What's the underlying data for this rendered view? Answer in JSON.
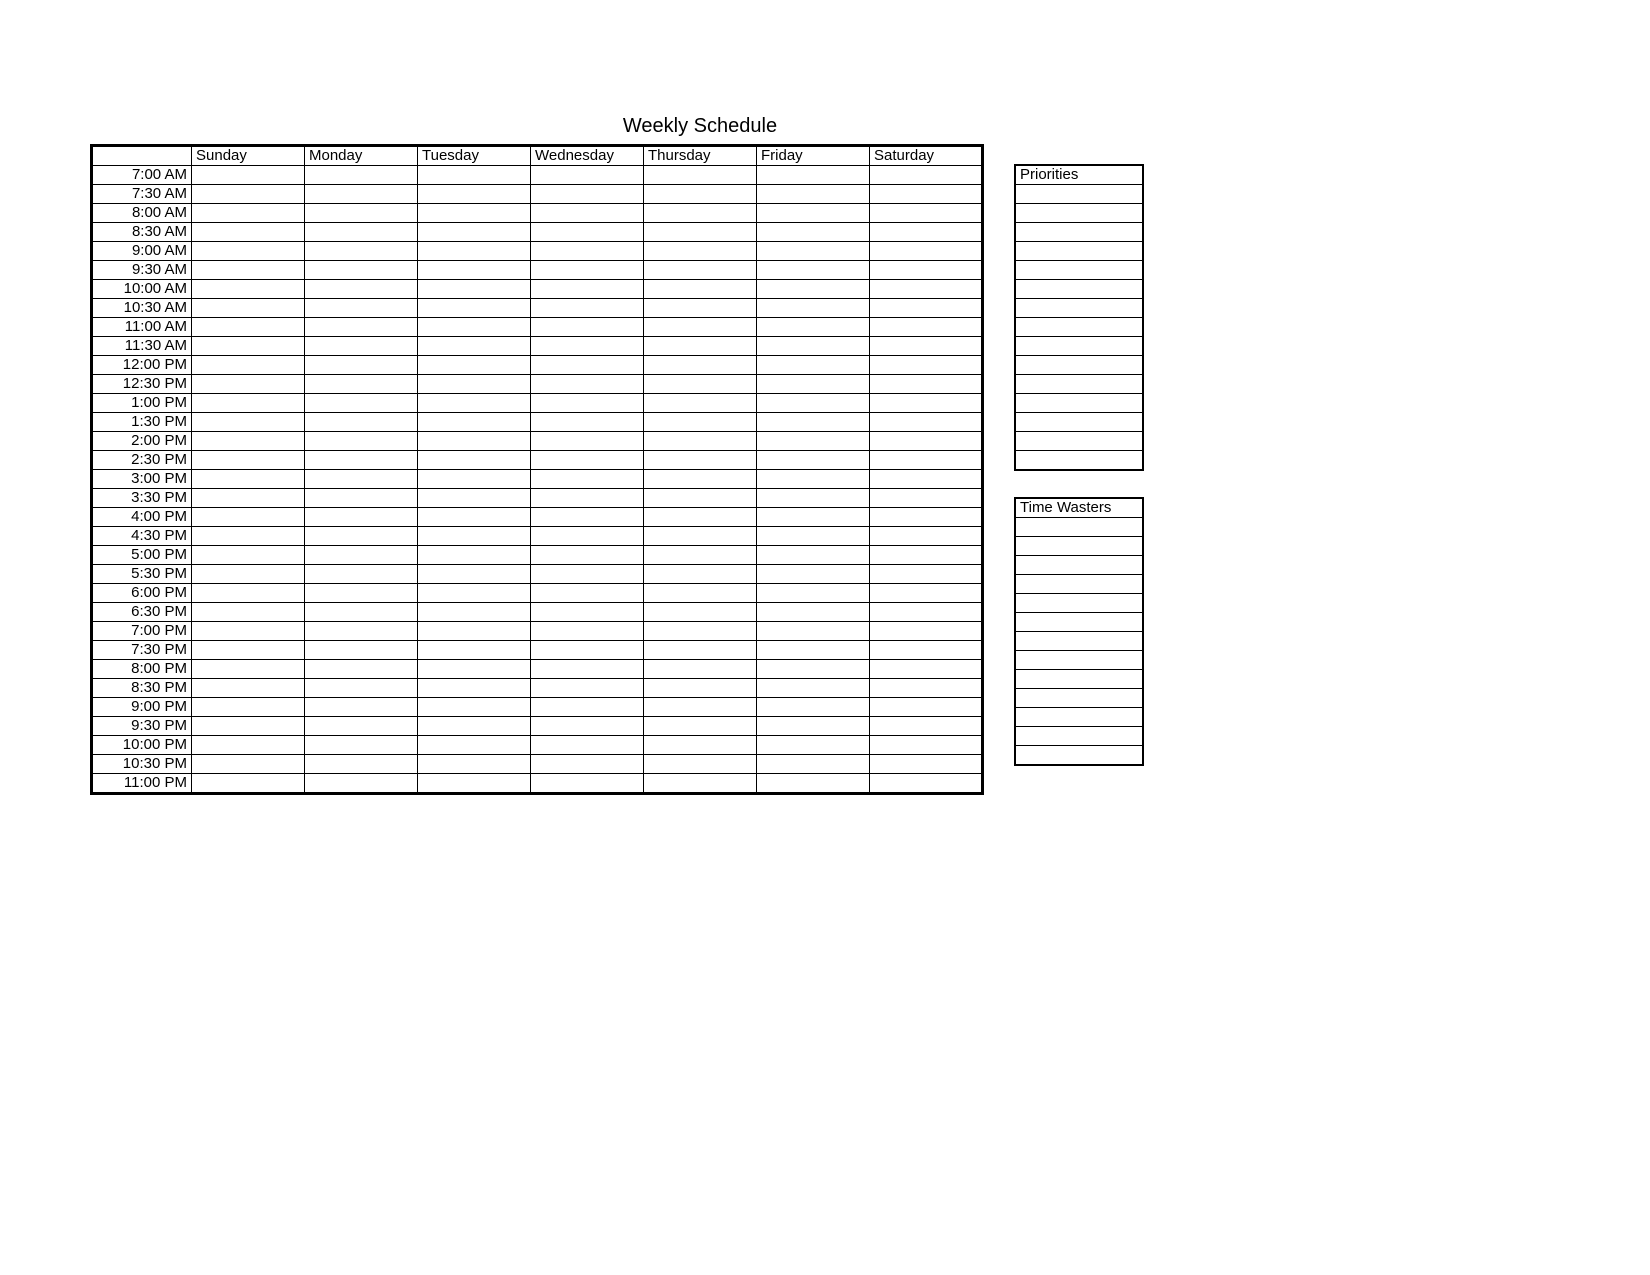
{
  "title": "Weekly Schedule",
  "days": [
    "Sunday",
    "Monday",
    "Tuesday",
    "Wednesday",
    "Thursday",
    "Friday",
    "Saturday"
  ],
  "times": [
    "7:00 AM",
    "7:30 AM",
    "8:00 AM",
    "8:30 AM",
    "9:00 AM",
    "9:30 AM",
    "10:00 AM",
    "10:30 AM",
    "11:00 AM",
    "11:30 AM",
    "12:00 PM",
    "12:30 PM",
    "1:00 PM",
    "1:30 PM",
    "2:00 PM",
    "2:30 PM",
    "3:00 PM",
    "3:30 PM",
    "4:00 PM",
    "4:30 PM",
    "5:00 PM",
    "5:30 PM",
    "6:00 PM",
    "6:30 PM",
    "7:00 PM",
    "7:30 PM",
    "8:00 PM",
    "8:30 PM",
    "9:00 PM",
    "9:30 PM",
    "10:00 PM",
    "10:30 PM",
    "11:00 PM"
  ],
  "side": {
    "priorities": {
      "header": "Priorities",
      "rows": 15
    },
    "timewasters": {
      "header": "Time Wasters",
      "rows": 13
    }
  }
}
